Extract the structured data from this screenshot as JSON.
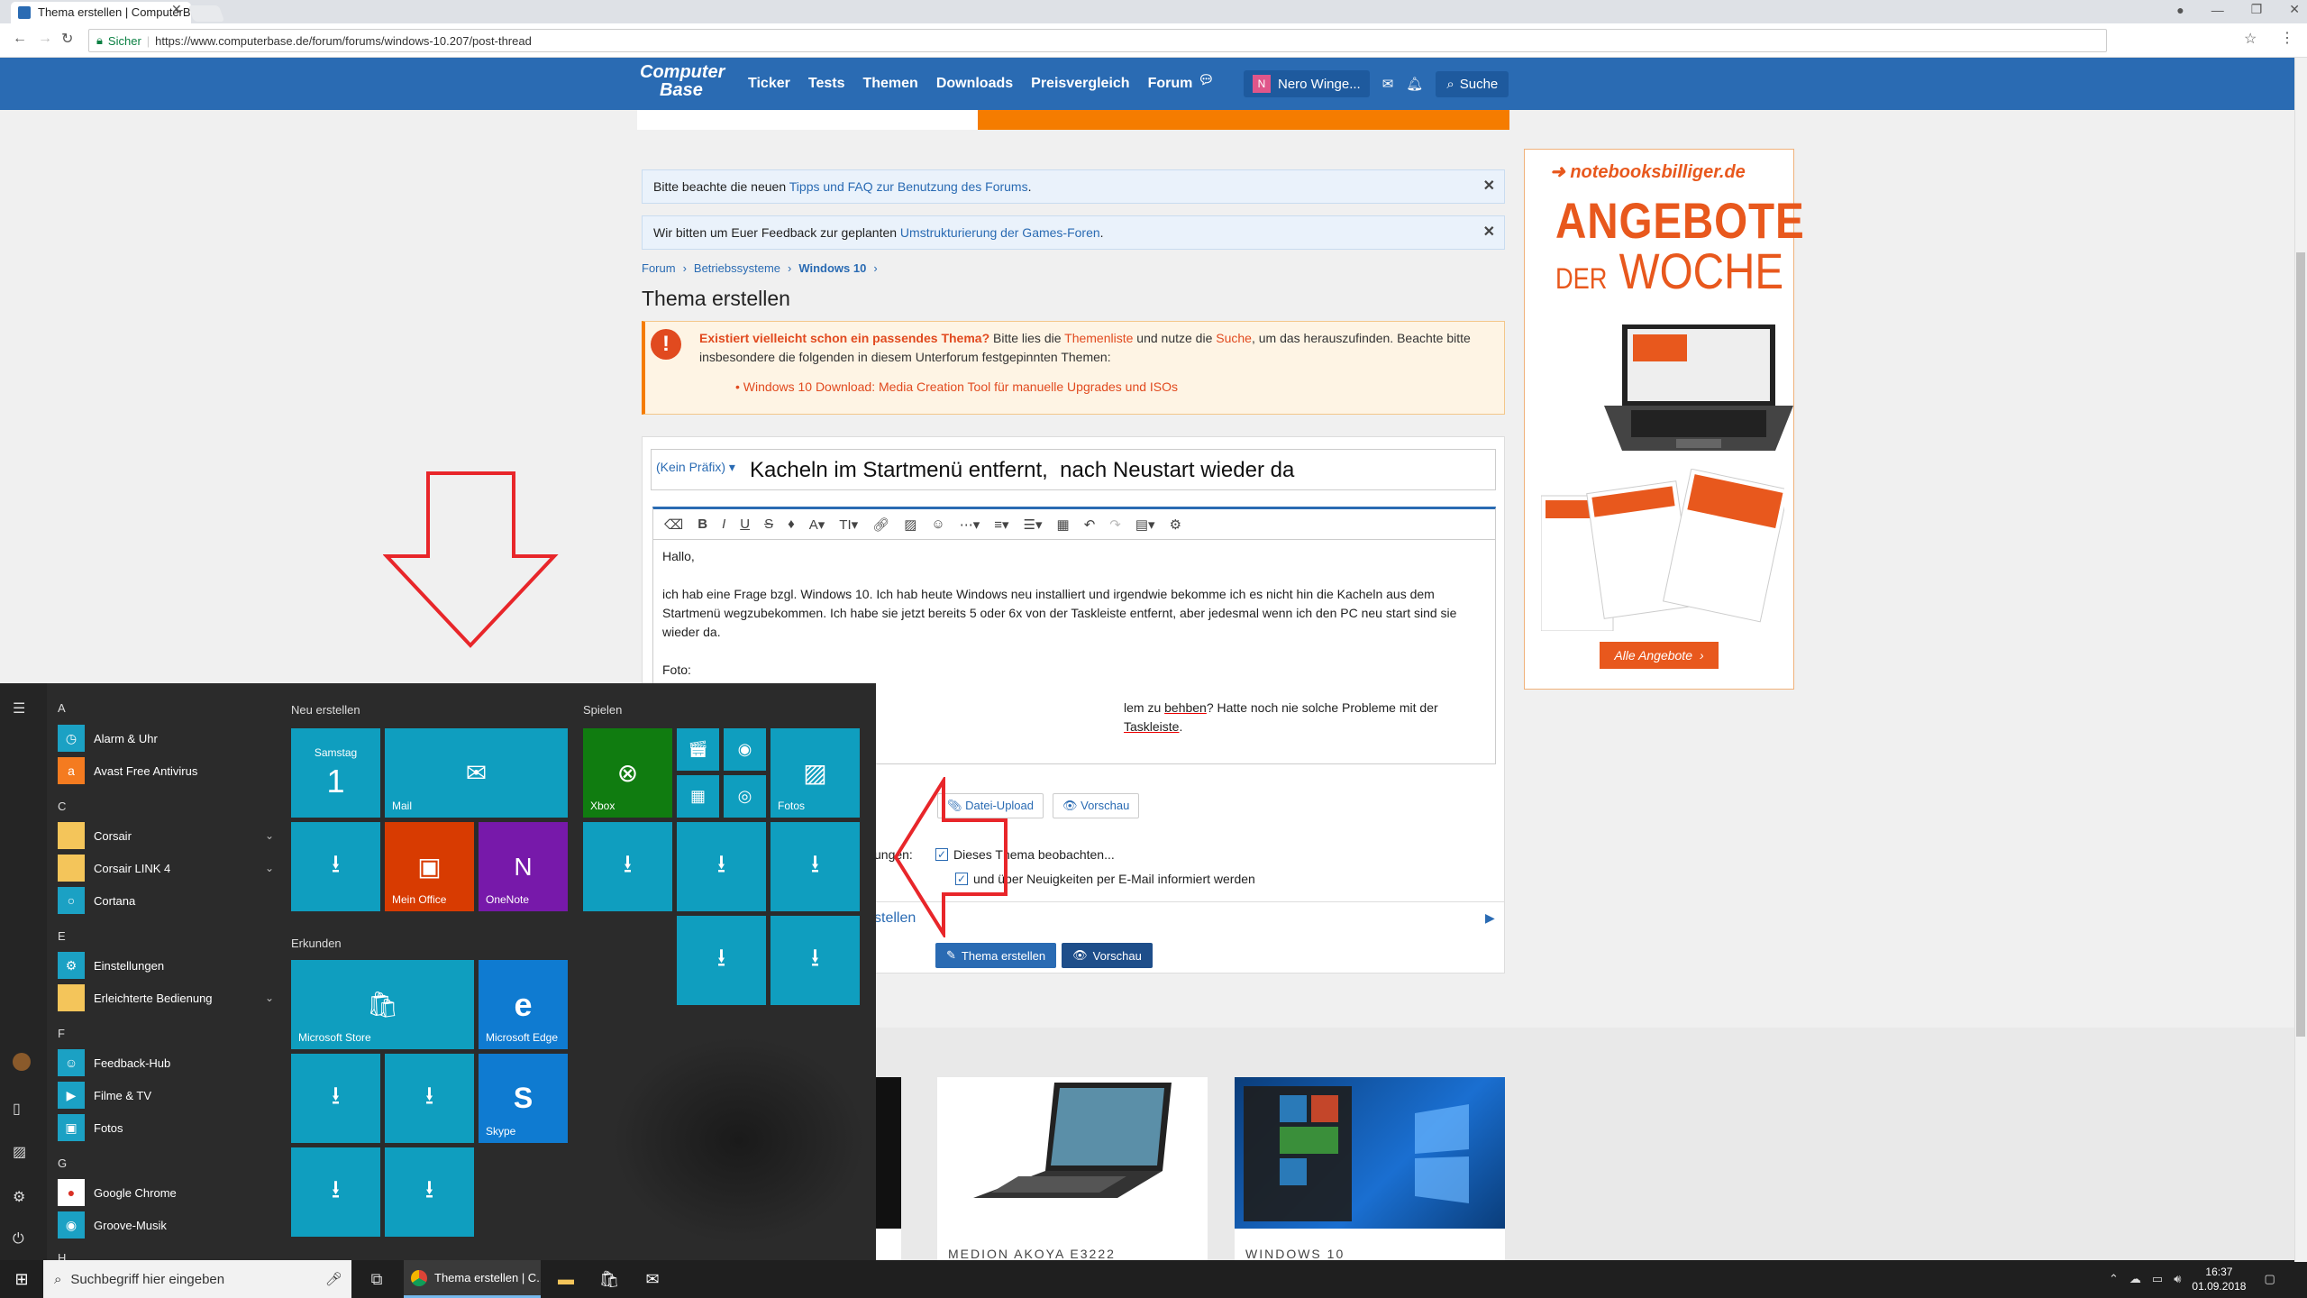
{
  "browser": {
    "tab_title": "Thema erstellen | ComputerBase",
    "secure_label": "Sicher",
    "url": "https://www.computerbase.de/forum/forums/windows-10.207/post-thread"
  },
  "site": {
    "logo_top": "Computer",
    "logo_bottom": "Base",
    "nav": [
      "Ticker",
      "Tests",
      "Themen",
      "Downloads",
      "Preisvergleich",
      "Forum"
    ],
    "user_initial": "N",
    "user_name": "Nero Winge...",
    "search_label": "Suche"
  },
  "notices": [
    {
      "before": "Bitte beachte die neuen ",
      "link": "Tipps und FAQ zur Benutzung des Forums",
      "after": "."
    },
    {
      "before": "Wir bitten um Euer Feedback zur geplanten ",
      "link": "Umstrukturierung der Games-Foren",
      "after": "."
    }
  ],
  "breadcrumb": [
    "Forum",
    "Betriebssysteme",
    "Windows 10"
  ],
  "page_title": "Thema erstellen",
  "warning": {
    "bold": "Existiert vielleicht schon ein passendes Thema?",
    "t1": " Bitte lies die ",
    "link1": "Themenliste",
    "t2": " und nutze die ",
    "link2": "Suche",
    "t3": ", um das herauszufinden. Beachte bitte insbesondere die folgenden in diesem Unterforum festgepinnten Themen:",
    "item": "Windows 10 Download: Media Creation Tool für manuelle Upgrades und ISOs"
  },
  "form": {
    "prefix": "(Kein Präfix)",
    "title_value": "Kacheln im Startmenü entfernt,  nach Neustart wieder da",
    "body_p1": "Hallo,",
    "body_p2": "ich hab eine Frage bzgl. Windows 10. Ich hab heute Windows neu installiert und irgendwie bekomme ich es nicht hin die Kacheln aus dem Startmenü wegzubekommen. Ich habe sie jetzt bereits 5 oder 6x von der Taskleiste entfernt, aber jedesmal wenn ich den PC neu start sind sie wieder da.",
    "body_p3": "Foto:",
    "body_p4a": "lem zu ",
    "body_p4b": "behben",
    "body_p4c": "? Hatte noch nie solche Probleme mit der ",
    "body_p4d": "Taskleiste",
    "body_p4e": ".",
    "upload_label": "Datei-Upload",
    "preview_label": "Vorschau",
    "options_fragment": "ungen:",
    "watch_label": "Dieses Thema beobachten...",
    "email_label": "und über Neuigkeiten per E-Mail informiert werden",
    "more_fragment": "stellen",
    "submit_label": "Thema erstellen",
    "submit_preview_label": "Vorschau"
  },
  "products": [
    "MEDION AKOYA E3222",
    "WINDOWS 10"
  ],
  "ad": {
    "brand": "notebooksbilliger.de",
    "headline1": "ANGEBOTE",
    "headline2a": "DER",
    "headline2b": "WOCHE",
    "button": "Alle Angebote"
  },
  "start_menu": {
    "letters": [
      "A",
      "C",
      "E",
      "F",
      "G",
      "H"
    ],
    "apps": [
      {
        "label": "Alarm & Uhr",
        "icon": "clock-icon",
        "glyph": "◷",
        "color": "#1ba1c4"
      },
      {
        "label": "Avast Free Antivirus",
        "icon": "avast-icon",
        "glyph": "a",
        "color": "#f47b20"
      },
      {
        "label": "Corsair",
        "icon": "folder-icon",
        "glyph": "",
        "color": "#f4c55a"
      },
      {
        "label": "Corsair LINK 4",
        "icon": "folder-icon",
        "glyph": "",
        "color": "#f4c55a"
      },
      {
        "label": "Cortana",
        "icon": "cortana-icon",
        "glyph": "○",
        "color": "#1ba1c4"
      },
      {
        "label": "Einstellungen",
        "icon": "gear-icon",
        "glyph": "⚙",
        "color": "#1ba1c4"
      },
      {
        "label": "Erleichterte Bedienung",
        "icon": "folder-icon",
        "glyph": "",
        "color": "#f4c55a"
      },
      {
        "label": "Feedback-Hub",
        "icon": "feedback-icon",
        "glyph": "☺",
        "color": "#1ba1c4"
      },
      {
        "label": "Filme & TV",
        "icon": "film-icon",
        "glyph": "▶",
        "color": "#1ba1c4"
      },
      {
        "label": "Fotos",
        "icon": "photo-icon",
        "glyph": "▣",
        "color": "#1ba1c4"
      },
      {
        "label": "Google Chrome",
        "icon": "chrome-icon",
        "glyph": "●",
        "color": "#ffffff"
      },
      {
        "label": "Groove-Musik",
        "icon": "music-icon",
        "glyph": "◉",
        "color": "#1ba1c4"
      }
    ],
    "groups": [
      "Neu erstellen",
      "Spielen",
      "Erkunden"
    ],
    "tiles": {
      "calendar_day": "Samstag",
      "calendar_date": "1",
      "mail": "Mail",
      "office": "Mein Office",
      "onenote": "OneNote",
      "xbox": "Xbox",
      "fotos": "Fotos",
      "store": "Microsoft Store",
      "edge": "Microsoft Edge",
      "skype": "Skype"
    }
  },
  "taskbar": {
    "search_placeholder": "Suchbegriff hier eingeben",
    "chrome_label": "Thema erstellen | C...",
    "time": "16:37",
    "date": "01.09.2018"
  }
}
